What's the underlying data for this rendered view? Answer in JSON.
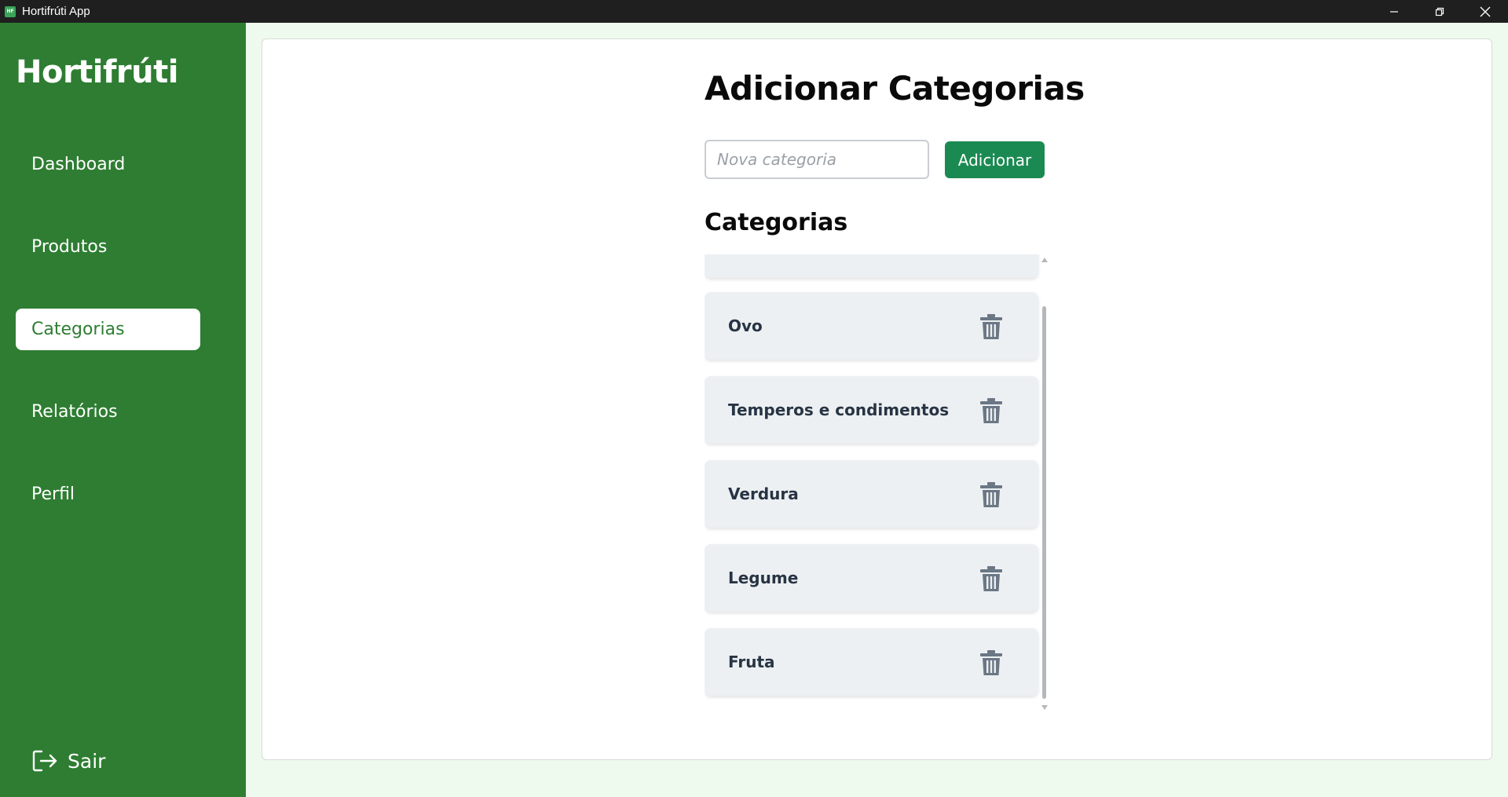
{
  "window": {
    "title": "Hortifrúti App",
    "icon_text": "HF",
    "controls": [
      "minimize-icon",
      "restore-icon",
      "close-icon"
    ]
  },
  "sidebar": {
    "brand": "Hortifrúti",
    "items": [
      {
        "label": "Dashboard",
        "active": false
      },
      {
        "label": "Produtos",
        "active": false
      },
      {
        "label": "Categorias",
        "active": true
      },
      {
        "label": "Relatórios",
        "active": false
      },
      {
        "label": "Perfil",
        "active": false
      }
    ],
    "logout_label": "Sair",
    "logout_icon": "logout-icon"
  },
  "main": {
    "title": "Adicionar Categorias",
    "input_placeholder": "Nova categoria",
    "input_value": "",
    "add_button": "Adicionar",
    "list_title": "Categorias",
    "categories": [
      "Ovo",
      "Temperos e condimentos",
      "Verdura",
      "Legume",
      "Fruta"
    ],
    "delete_icon": "trash-icon"
  },
  "colors": {
    "sidebar_bg": "#2e7d32",
    "accent_button": "#1b8a52",
    "page_bg": "#eefaee",
    "item_bg": "#edf0f2",
    "item_text": "#273444",
    "icon": "#6b7785"
  }
}
